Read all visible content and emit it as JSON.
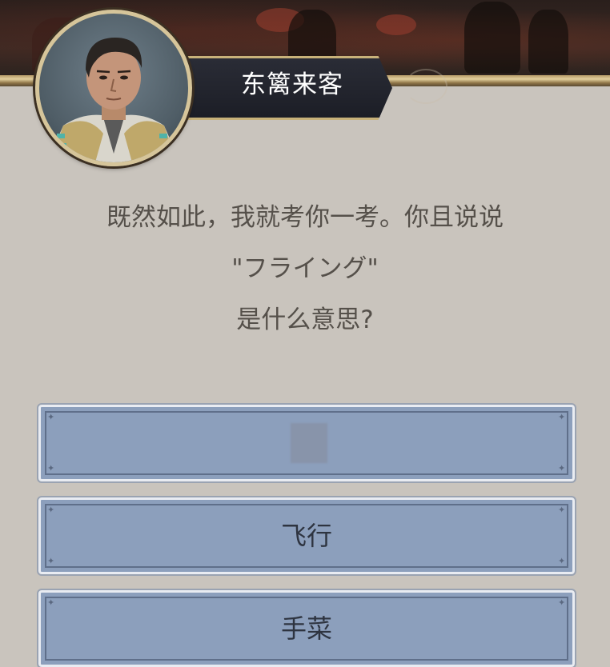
{
  "speaker": {
    "name": "东篱来客",
    "portrait": "npc-portrait"
  },
  "dialog": {
    "line1": "既然如此，我就考你一考。你且说说",
    "line2": "\"フライング\"",
    "line3": "是什么意思?"
  },
  "answers": [
    {
      "label": ""
    },
    {
      "label": "飞行"
    },
    {
      "label": "手菜"
    }
  ],
  "colors": {
    "panel": "#c9c4bd",
    "answer_fill": "#8c9fbc",
    "nameplate": "#1c1e26",
    "gold_trim": "#c8b27a"
  }
}
